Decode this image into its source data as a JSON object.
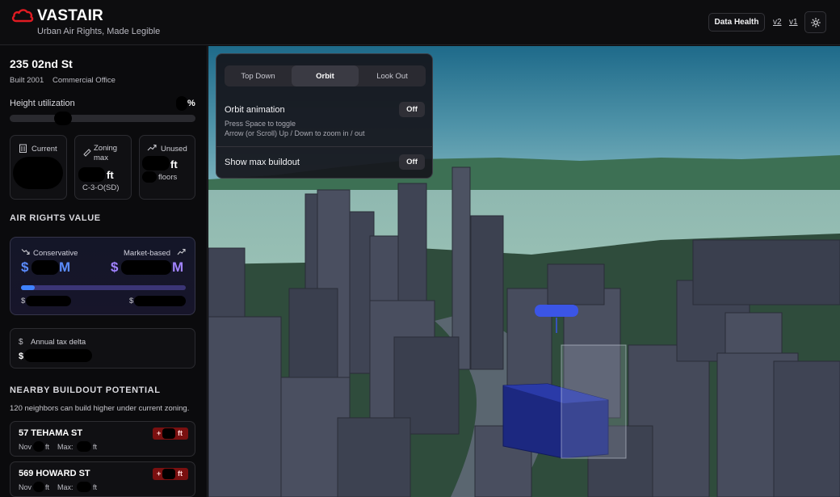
{
  "header": {
    "brand": "VASTAIR",
    "tagline": "Urban Air Rights, Made Legible",
    "data_health_label": "Data Health",
    "version_links": [
      "v2",
      "v1"
    ],
    "theme_icon": "sun-icon",
    "brand_color": "#e01b22"
  },
  "property": {
    "address": "235 02nd St",
    "built": "Built 2001",
    "use": "Commercial Office",
    "height_utilization_label": "Height utilization",
    "pct_symbol": "%"
  },
  "stats": {
    "current_label": "Current",
    "zoning_label_line1": "Zoning",
    "zoning_label_line2": "max",
    "zoning_unit": "ft",
    "zoning_code": "C-3-O(SD)",
    "unused_label": "Unused",
    "unused_unit": "ft",
    "unused_floors": "floors"
  },
  "air_rights": {
    "section_title": "AIR RIGHTS VALUE",
    "conservative_label": "Conservative",
    "market_label": "Market-based",
    "currency": "$",
    "million_suffix": "M",
    "low_prefix": "$",
    "high_prefix": "$",
    "accent_blue": "#5b8cff",
    "accent_purple": "#a183ff"
  },
  "tax": {
    "label": "Annual tax delta",
    "prefix": "$"
  },
  "nearby": {
    "section_title": "NEARBY BUILDOUT POTENTIAL",
    "subtitle": "120 neighbors can build higher under current zoning.",
    "items": [
      {
        "name": "57 TEHAMA ST",
        "now_label": "Nov",
        "ft1": "ft",
        "max_label": "Max:",
        "ft2": "ft",
        "badge_plus": "+",
        "badge_unit": "ft"
      },
      {
        "name": "569 HOWARD ST",
        "now_label": "Nov",
        "ft1": "ft",
        "max_label": "Max:",
        "ft2": "ft",
        "badge_plus": "+",
        "badge_unit": "ft"
      }
    ]
  },
  "view_panel": {
    "modes": [
      "Top Down",
      "Orbit",
      "Look Out"
    ],
    "active_mode": "Orbit",
    "orbit_title": "Orbit animation",
    "orbit_state": "Off",
    "help_line1": "Press Space to toggle",
    "help_line2": "Arrow (or Scroll) Up / Down to zoom in / out",
    "buildout_title": "Show max buildout",
    "buildout_state": "Off"
  }
}
